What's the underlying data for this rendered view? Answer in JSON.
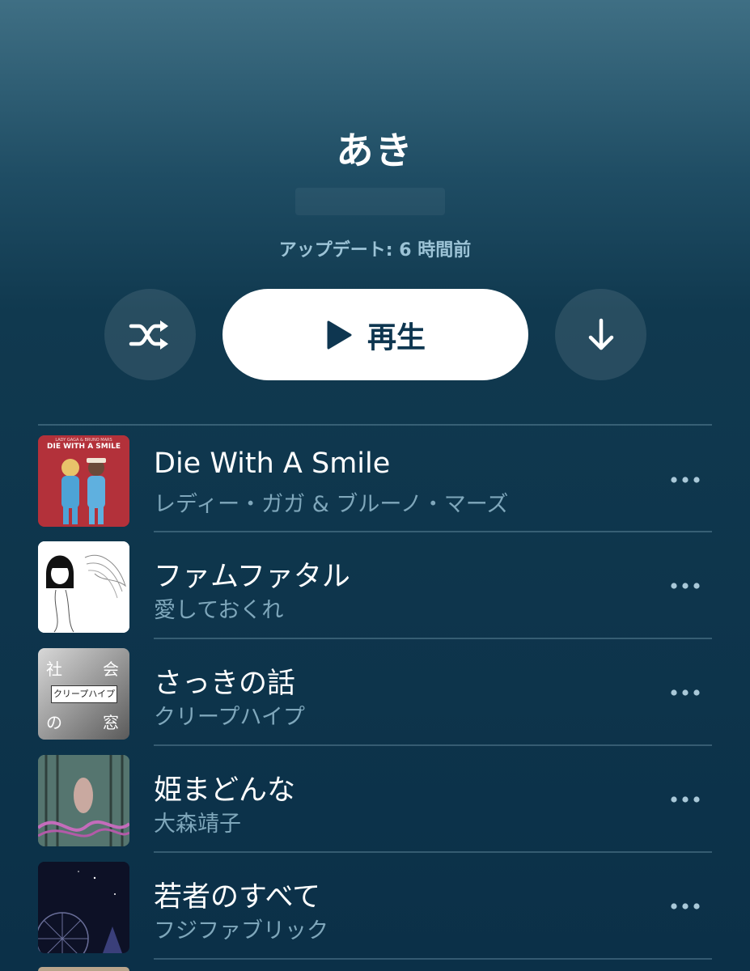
{
  "playlist": {
    "title": "あき",
    "updated": "アップデート: 6 時間前"
  },
  "controls": {
    "play_label": "再生",
    "shuffle_icon": "shuffle-icon",
    "download_icon": "download-arrow-icon",
    "play_icon": "play-icon"
  },
  "colors": {
    "background_top": "#3f6f84",
    "background_bottom": "#0b3048",
    "accent": "#0e3650",
    "subtitle": "#7fa7bb"
  },
  "tracks": [
    {
      "title": "Die With A Smile",
      "artist": "レディー・ガガ & ブルーノ・マーズ",
      "art_text": "DIE WITH A SMILE",
      "art_small": "LADY GAGA & BRUNO MARS"
    },
    {
      "title": "ファムファタル",
      "artist": "愛しておくれ"
    },
    {
      "title": "さっきの話",
      "artist": "クリープハイプ",
      "art_chars": [
        "社",
        "会",
        "の",
        "窓"
      ],
      "art_band": "クリープハイプ"
    },
    {
      "title": "姫まどんな",
      "artist": "大森靖子"
    },
    {
      "title": "若者のすべて",
      "artist": "フジファブリック"
    }
  ]
}
